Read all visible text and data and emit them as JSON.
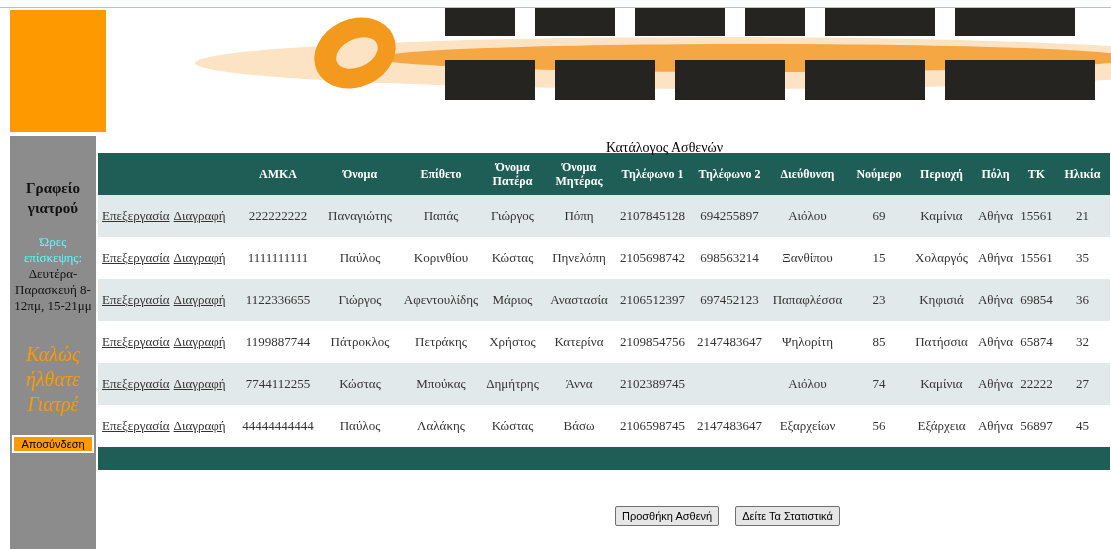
{
  "sidebar": {
    "title": "Γραφείο γιατρού",
    "hours_label": "Ώρες επίσκεψης:",
    "hours": "Δευτέρα-Παρασκευή 8-12πμ, 15-21μμ",
    "welcome": "Καλώς ήλθατε Γιατρέ",
    "logout": "Αποσύνδεση"
  },
  "table": {
    "caption": "Κατάλογος Ασθενών",
    "columns": [
      "ΑΜΚΑ",
      "Όνομα",
      "Επίθετο",
      "Όνομα Πατέρα",
      "Όνομα Μητέρας",
      "Τηλέφωνο 1",
      "Τηλέφωνο 2",
      "Διεύθυνση",
      "Νούμερο",
      "Περιοχή",
      "Πόλη",
      "ΤΚ",
      "Ηλικία"
    ],
    "rows": [
      {
        "edit": "Επεξεργασία",
        "delete": "Διαγραφή",
        "cells": [
          "222222222",
          "Παναγιώτης",
          "Παπάς",
          "Γιώργος",
          "Πόπη",
          "2107845128",
          "694255897",
          "Αιόλου",
          "69",
          "Καμίνια",
          "Αθήνα",
          "15561",
          "21"
        ]
      },
      {
        "edit": "Επεξεργασία",
        "delete": "Διαγραφή",
        "cells": [
          "1111111111",
          "Παύλος",
          "Κορινθίου",
          "Κώστας",
          "Πηνελόπη",
          "2105698742",
          "698563214",
          "Ξανθίπου",
          "15",
          "Χολαργός",
          "Αθήνα",
          "15561",
          "35"
        ]
      },
      {
        "edit": "Επεξεργασία",
        "delete": "Διαγραφή",
        "cells": [
          "1122336655",
          "Γιώργος",
          "Αφεντουλίδης",
          "Μάριος",
          "Αναστασία",
          "2106512397",
          "697452123",
          "Παπαφλέσσα",
          "23",
          "Κηφισιά",
          "Αθήνα",
          "69854",
          "36"
        ]
      },
      {
        "edit": "Επεξεργασία",
        "delete": "Διαγραφή",
        "cells": [
          "1199887744",
          "Πάτροκλος",
          "Πετράκης",
          "Χρήστος",
          "Κατερίνα",
          "2109854756",
          "2147483647",
          "Ψηλορίτη",
          "85",
          "Πατήσσια",
          "Αθήνα",
          "65874",
          "32"
        ]
      },
      {
        "edit": "Επεξεργασία",
        "delete": "Διαγραφή",
        "cells": [
          "7744112255",
          "Κώστας",
          "Μπούκας",
          "Δημήτρης",
          "Άννα",
          "2102389745",
          null,
          "Αιόλου",
          "74",
          "Καμίνια",
          "Αθήνα",
          "22222",
          "27"
        ]
      },
      {
        "edit": "Επεξεργασία",
        "delete": "Διαγραφή",
        "cells": [
          "44444444444",
          "Παύλος",
          "Λαλάκης",
          "Κώστας",
          "Βάσω",
          "2106598745",
          "2147483647",
          "Εξαρχείων",
          "56",
          "Εξάρχεια",
          "Αθήνα",
          "56897",
          "45"
        ]
      }
    ]
  },
  "buttons": [
    "Προσθήκη Ασθενή",
    "Δείτε Τα Στατιστικά"
  ]
}
